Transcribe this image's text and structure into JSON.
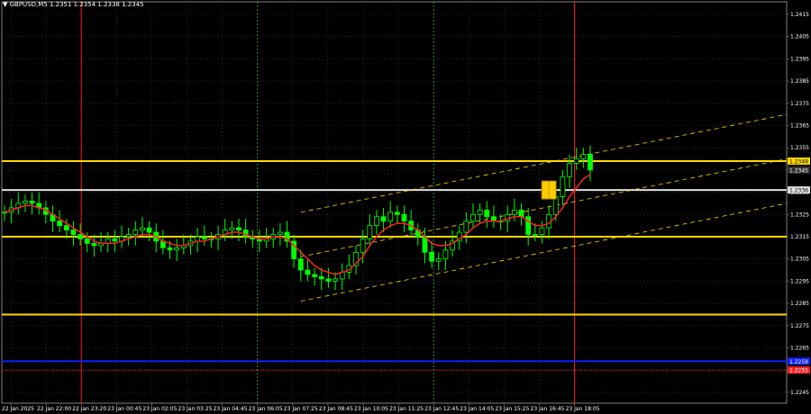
{
  "window": {
    "symbol_line": "▼ GBPUSD,M5  1.2351 1.2354 1.2338 1.2345"
  },
  "colors": {
    "background": "#000000",
    "candle_up": "#00ff00",
    "candle_down": "#00ff00",
    "ma": "#ff2020",
    "level": "#ffd700",
    "channel": "#ffd700",
    "session_line": "#ff2020",
    "grid_vertical": "#3a8a3a",
    "grid": "#404040",
    "blue_level": "#1020ff",
    "red_dotted": "#ff2020",
    "price_tag_dark": "#303030"
  },
  "chart_data": {
    "type": "candlestick",
    "symbol": "GBPUSD",
    "timeframe": "M5",
    "ohlc_header": {
      "open": 1.2351,
      "high": 1.2354,
      "low": 1.2338,
      "close": 1.2345
    },
    "ylim": [
      1.2241,
      1.2421
    ],
    "y_ticks": [
      "1.2415",
      "1.2405",
      "1.2395",
      "1.2385",
      "1.2375",
      "1.2365",
      "1.2355",
      "1.2345",
      "1.2335",
      "1.2325",
      "1.2315",
      "1.2305",
      "1.2295",
      "1.2285",
      "1.2275",
      "1.2265",
      "1.2255",
      "1.2245"
    ],
    "x_ticks": [
      "22 Jan 2025",
      "22 Jan 22:00",
      "22 Jan 23:20",
      "23 Jan 00:45",
      "23 Jan 02:05",
      "23 Jan 03:25",
      "23 Jan 04:45",
      "23 Jan 06:05",
      "23 Jan 07:25",
      "23 Jan 08:45",
      "23 Jan 10:05",
      "23 Jan 11:25",
      "23 Jan 12:45",
      "23 Jan 14:05",
      "23 Jan 15:25",
      "23 Jan 16:45",
      "23 Jan 18:05"
    ],
    "price_labels": [
      {
        "text": "1.2349",
        "value": 1.2349,
        "style": "yellow"
      },
      {
        "text": "1.2345",
        "value": 1.2345,
        "style": "dark"
      },
      {
        "text": "1.2336",
        "value": 1.2336,
        "style": "white"
      },
      {
        "text": "1.2259",
        "value": 1.2259,
        "style": "blue"
      },
      {
        "text": "1.2255",
        "value": 1.2255,
        "style": "red"
      }
    ],
    "horizontal_levels": [
      {
        "value": 1.2349,
        "color": "#ffd700",
        "style": "solid"
      },
      {
        "value": 1.2336,
        "color": "#e0e0e0",
        "style": "solid"
      },
      {
        "value": 1.2315,
        "color": "#ffd700",
        "style": "solid"
      },
      {
        "value": 1.228,
        "color": "#ffd700",
        "style": "solid"
      },
      {
        "value": 1.2259,
        "color": "#1020ff",
        "style": "solid"
      },
      {
        "value": 1.2255,
        "color": "#ff2020",
        "style": "dotted"
      }
    ],
    "vertical_lines": [
      {
        "at": "22 Jan 23:20",
        "color": "#ff2020",
        "style": "solid"
      },
      {
        "at": "23 Jan 06:05",
        "color": "#3a8a3a",
        "style": "dashed"
      },
      {
        "at": "23 Jan 12:45",
        "color": "#3a8a3a",
        "style": "dashed"
      },
      {
        "at": "23 Jan 18:05",
        "color": "#ff2020",
        "style": "solid"
      }
    ],
    "close_series": [
      1.2326,
      1.2328,
      1.233,
      1.2331,
      1.233,
      1.2328,
      1.2325,
      1.2322,
      1.232,
      1.2318,
      1.2316,
      1.2314,
      1.2312,
      1.2311,
      1.2312,
      1.2314,
      1.2313,
      1.2315,
      1.2316,
      1.2318,
      1.2319,
      1.2317,
      1.2313,
      1.231,
      1.2309,
      1.231,
      1.2311,
      1.2313,
      1.2315,
      1.2314,
      1.2314,
      1.2316,
      1.2318,
      1.2319,
      1.2318,
      1.2315,
      1.2314,
      1.2313,
      1.2314,
      1.2316,
      1.2317,
      1.2313,
      1.2305,
      1.23,
      1.2298,
      1.2297,
      1.2296,
      1.2295,
      1.2296,
      1.2299,
      1.2302,
      1.2308,
      1.2314,
      1.232,
      1.2324,
      1.2322,
      1.2326,
      1.2325,
      1.2322,
      1.2318,
      1.2315,
      1.2308,
      1.2304,
      1.2305,
      1.2309,
      1.2313,
      1.2317,
      1.2322,
      1.2325,
      1.2327,
      1.2324,
      1.2322,
      1.2322,
      1.2325,
      1.2327,
      1.2324,
      1.2316,
      1.2316,
      1.2319,
      1.2325,
      1.2333,
      1.2342,
      1.2348,
      1.235,
      1.2352,
      1.2345
    ],
    "ma_series": [
      1.2326,
      1.2327,
      1.2328,
      1.2329,
      1.2329,
      1.2328,
      1.2327,
      1.2325,
      1.2323,
      1.2321,
      1.2319,
      1.2317,
      1.2315,
      1.2313,
      1.2312,
      1.2312,
      1.2312,
      1.2313,
      1.2314,
      1.2315,
      1.2316,
      1.2316,
      1.2315,
      1.2313,
      1.2312,
      1.2311,
      1.2311,
      1.2312,
      1.2313,
      1.2313,
      1.2314,
      1.2315,
      1.2316,
      1.2317,
      1.2317,
      1.2316,
      1.2315,
      1.2314,
      1.2314,
      1.2315,
      1.2315,
      1.2314,
      1.2311,
      1.2308,
      1.2305,
      1.2302,
      1.23,
      1.2299,
      1.2298,
      1.2299,
      1.23,
      1.2303,
      1.2306,
      1.2311,
      1.2315,
      1.2318,
      1.232,
      1.2321,
      1.2321,
      1.232,
      1.2318,
      1.2315,
      1.2312,
      1.2311,
      1.2311,
      1.2312,
      1.2314,
      1.2316,
      1.2319,
      1.2321,
      1.2322,
      1.2322,
      1.2322,
      1.2323,
      1.2324,
      1.2324,
      1.2322,
      1.232,
      1.232,
      1.2321,
      1.2324,
      1.2328,
      1.2333,
      1.2337,
      1.2341,
      1.2343
    ],
    "channel": {
      "start_time_index": 43,
      "end_time_index": 95,
      "lines": [
        {
          "start": 1.2326,
          "end": 1.237
        },
        {
          "start": 1.2306,
          "end": 1.235
        },
        {
          "start": 1.2286,
          "end": 1.233
        }
      ]
    },
    "signal_marker": {
      "time_index": 79,
      "value": 1.2336,
      "color": "#ffcc00"
    }
  }
}
